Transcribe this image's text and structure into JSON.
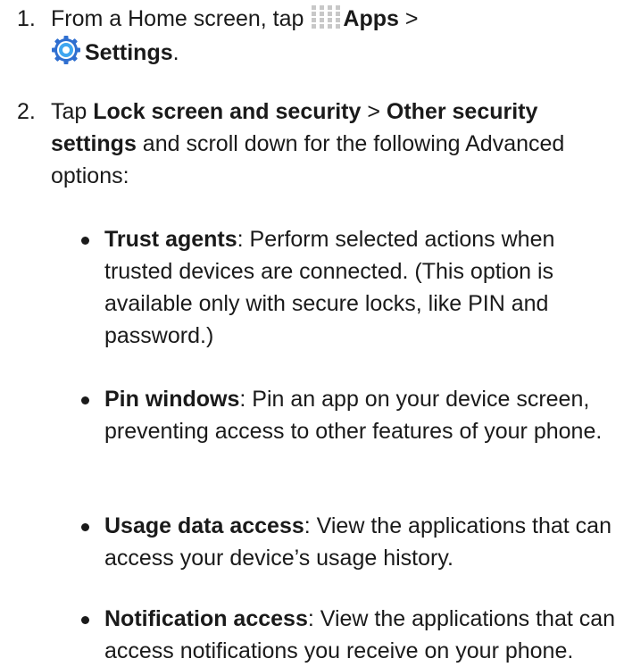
{
  "steps": [
    {
      "number": "1.",
      "pre": "From a Home screen, tap ",
      "apps": "Apps",
      "sep": " >",
      "settings": "Settings",
      "post": "."
    },
    {
      "number": "2.",
      "pre": "Tap ",
      "lock": "Lock screen and security",
      "sep": " > ",
      "other": "Other security settings",
      "post": " and scroll down for the following Advanced options:"
    }
  ],
  "options": [
    {
      "term": "Trust agents",
      "desc": ": Perform selected actions when trusted devices are connected. (This option is available only with secure locks, like PIN and password.)"
    },
    {
      "term": "Pin windows",
      "desc": ": Pin an app on your device screen, preventing access to other features of your phone."
    },
    {
      "term": "Usage data access",
      "desc": ": View the applications that can access your device’s usage history."
    },
    {
      "term": "Notification access",
      "desc": ": View the applications that can access notifications you receive on your phone."
    }
  ],
  "icons": {
    "apps": "apps-grid-icon",
    "settings": "settings-gear-icon"
  },
  "colors": {
    "text": "#1a1a1a",
    "apps_icon": "#c8c8c8",
    "settings_icon_outer": "#2f6fd0",
    "settings_icon_inner": "#3fa6f0"
  }
}
